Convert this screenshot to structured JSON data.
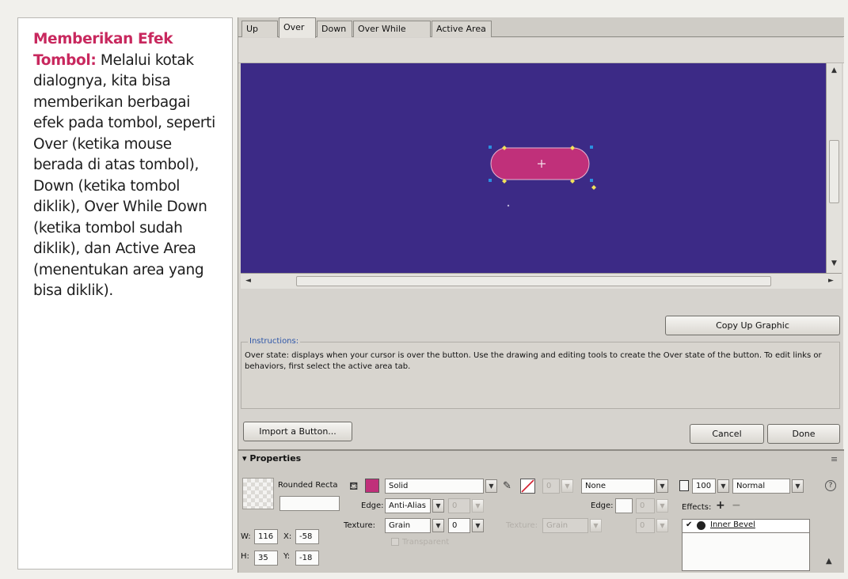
{
  "caption": {
    "lead": "Memberikan Efek Tombol:",
    "body": " Melalui kotak dialognya, kita bisa memberikan berbagai efek pada tombol, seperti Over (ketika mouse berada di atas tombol), Down (ketika tombol diklik), Over While Down (ketika tombol sudah diklik), dan Active Area (menentukan area yang bisa diklik)."
  },
  "tabs": [
    {
      "label": "Up"
    },
    {
      "label": "Over"
    },
    {
      "label": "Down"
    },
    {
      "label": "Over While Down"
    },
    {
      "label": "Active Area"
    }
  ],
  "active_tab": "Over",
  "stage": {
    "background": "#3c2a86",
    "shape_color": "#c0307a"
  },
  "buttons": {
    "copy_up": "Copy Up Graphic",
    "import": "Import a Button...",
    "cancel": "Cancel",
    "done": "Done"
  },
  "instructions": {
    "label": "Instructions:",
    "text": "Over state: displays when your cursor is over the button. Use the drawing and editing tools to create the Over state of the button. To edit links or behaviors, first select the active area tab."
  },
  "properties": {
    "title": "Properties",
    "shape_name": "Rounded Recta",
    "shape_name_field": "",
    "fill_color": "#c0307a",
    "fill_type": "Solid",
    "edge_label": "Edge:",
    "edge_value": "Anti-Alias",
    "edge_amount": "0",
    "texture_label": "Texture:",
    "texture_value": "Grain",
    "texture_amount": "0",
    "transparent_label": "Transparent",
    "stroke_size": "0",
    "stroke_type": "None",
    "stroke_edge_label": "Edge:",
    "stroke_edge_amount": "0",
    "stroke_texture_label": "Texture:",
    "stroke_texture_value": "Grain",
    "stroke_texture_amount": "0",
    "opacity": "100",
    "blend_mode": "Normal",
    "effects_label": "Effects:",
    "effects": [
      {
        "name": "Inner Bevel",
        "enabled": true
      }
    ],
    "w_label": "W:",
    "w": "116",
    "h_label": "H:",
    "h": "35",
    "x_label": "X:",
    "x": "-58",
    "y_label": "Y:",
    "y": "-18"
  },
  "scroll": {
    "up_icon": "▲",
    "down_icon": "▼",
    "left_icon": "◄",
    "right_icon": "►",
    "grip_icon": "⁞",
    "hgrip_icon": "⁝"
  }
}
